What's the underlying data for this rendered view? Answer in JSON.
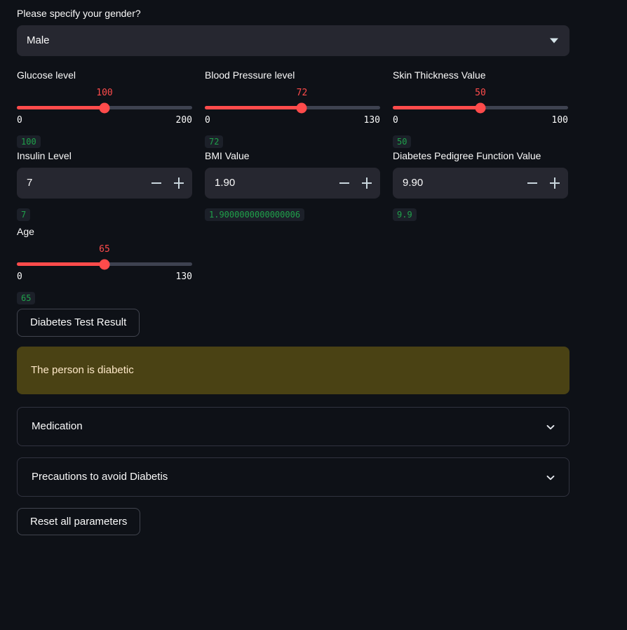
{
  "gender": {
    "label": "Please specify your gender?",
    "selected": "Male",
    "caret_icon": "caret-down-icon"
  },
  "sliders": [
    {
      "name": "glucose",
      "label": "Glucose level",
      "value": "100",
      "min": "0",
      "max": "200",
      "value_num": 100,
      "min_num": 0,
      "max_num": 200,
      "code": "100"
    },
    {
      "name": "blood-pressure",
      "label": "Blood Pressure level",
      "value": "72",
      "min": "0",
      "max": "130",
      "value_num": 72,
      "min_num": 0,
      "max_num": 130,
      "code": "72"
    },
    {
      "name": "skin-thickness",
      "label": "Skin Thickness Value",
      "value": "50",
      "min": "0",
      "max": "100",
      "value_num": 50,
      "min_num": 0,
      "max_num": 100,
      "code": "50"
    }
  ],
  "number_inputs": [
    {
      "name": "insulin",
      "label": "Insulin Level",
      "value": "7",
      "code": "7",
      "minus_icon": "minus-icon",
      "plus_icon": "plus-icon"
    },
    {
      "name": "bmi",
      "label": "BMI Value",
      "value": "1.90",
      "code": "1.9000000000000006",
      "minus_icon": "minus-icon",
      "plus_icon": "plus-icon"
    },
    {
      "name": "diabetes-pedigree-function",
      "label": "Diabetes Pedigree Function Value",
      "value": "9.90",
      "code": "9.9",
      "minus_icon": "minus-icon",
      "plus_icon": "plus-icon"
    }
  ],
  "age": {
    "label": "Age",
    "value": "65",
    "min": "0",
    "max": "130",
    "value_num": 65,
    "min_num": 0,
    "max_num": 130,
    "code": "65"
  },
  "result_button": {
    "label": "Diabetes Test Result"
  },
  "result_message": {
    "text": "The person is diabetic"
  },
  "expanders": [
    {
      "name": "medication",
      "label": "Medication",
      "icon": "chevron-down-icon"
    },
    {
      "name": "precautions",
      "label": "Precautions to avoid Diabetis",
      "icon": "chevron-down-icon"
    }
  ],
  "reset_button": {
    "label": "Reset all parameters"
  },
  "colors": {
    "background": "#0e1117",
    "widget_bg": "#262730",
    "accent_red": "#ff4b4b",
    "track_gray": "#3e4250",
    "code_green": "#1fa14a",
    "warning_bg": "#4a4214",
    "warning_text": "#ffe9c9",
    "text": "#fafafa"
  }
}
